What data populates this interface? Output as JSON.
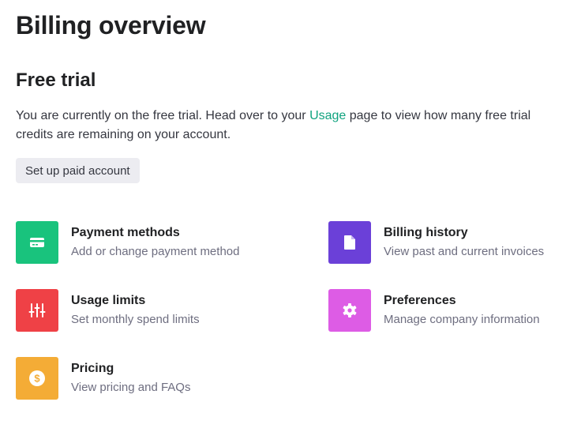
{
  "page": {
    "title": "Billing overview"
  },
  "free_trial": {
    "heading": "Free trial",
    "text_before": "You are currently on the free trial. Head over to your ",
    "usage_link": "Usage",
    "text_after": " page to view how many free trial credits are remaining on your account.",
    "button_label": "Set up paid account"
  },
  "cards": [
    {
      "title": "Payment methods",
      "subtitle": "Add or change payment method",
      "icon": "credit-card-icon",
      "color": "#19c37d"
    },
    {
      "title": "Billing history",
      "subtitle": "View past and current invoices",
      "icon": "document-icon",
      "color": "#6b40d8"
    },
    {
      "title": "Usage limits",
      "subtitle": "Set monthly spend limits",
      "icon": "sliders-icon",
      "color": "#ef4146"
    },
    {
      "title": "Preferences",
      "subtitle": "Manage company information",
      "icon": "gear-icon",
      "color": "#dd5ce5"
    },
    {
      "title": "Pricing",
      "subtitle": "View pricing and FAQs",
      "icon": "dollar-icon",
      "color": "#f4ac36"
    }
  ]
}
